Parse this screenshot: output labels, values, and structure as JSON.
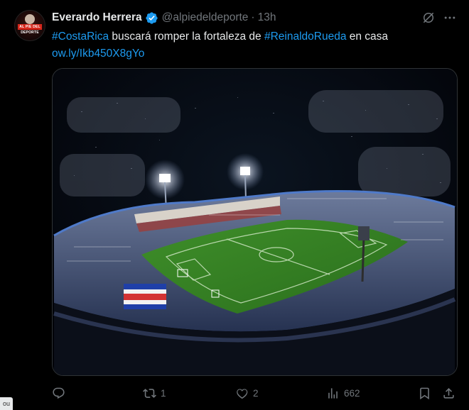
{
  "tweet": {
    "author_name": "Everardo Herrera",
    "handle": "@alpiedeldeporte",
    "separator": "·",
    "time": "13h",
    "avatar_banner": "AL PIE DEL DEPORTE",
    "text": {
      "hashtag1": "#CostaRica",
      "mid": " buscará romper la fortaleza de ",
      "hashtag2": "#ReinaldoRueda",
      "tail": " en casa",
      "link": "ow.ly/Ikb450X8gYo"
    }
  },
  "actions": {
    "reply_count": "",
    "retweet_count": "1",
    "like_count": "2",
    "views_count": "662"
  },
  "corner_tag": "ou",
  "colors": {
    "link": "#1d9bf0",
    "verified": "#1d9bf0",
    "muted": "#71767b",
    "pitch": "#2f7a1f"
  }
}
